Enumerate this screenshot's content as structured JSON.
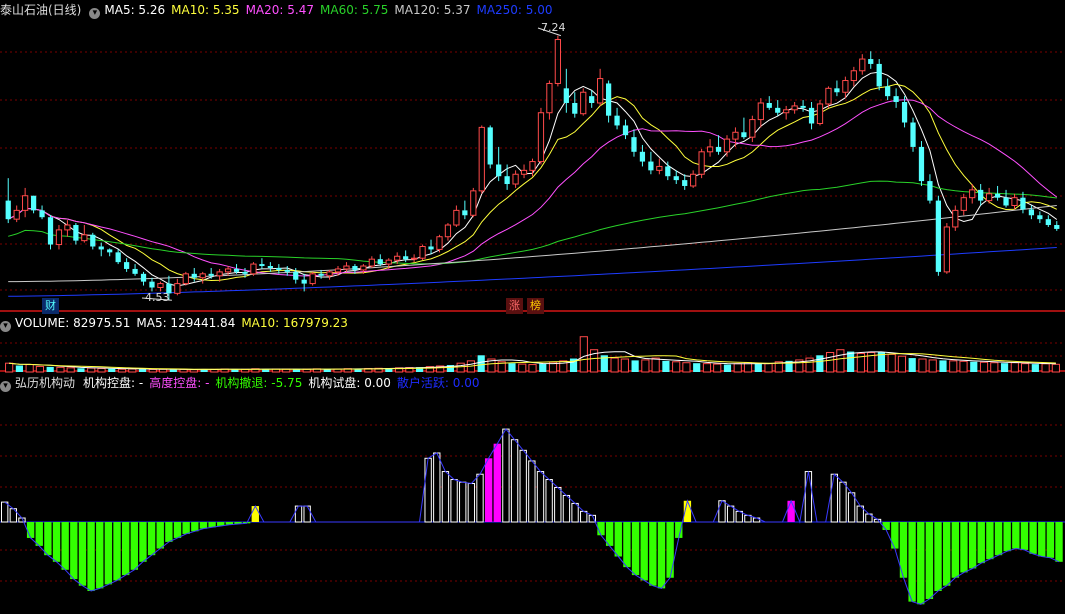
{
  "colors": {
    "up": "#ff4a4a",
    "down": "#54ffff",
    "ma5": "#ffffff",
    "ma10": "#ffff3c",
    "ma20": "#ff50ff",
    "ma60": "#29d129",
    "ma120": "#c8c8c8",
    "ma250": "#1e3cff",
    "divider": "#a01010",
    "grid": "#7a0000",
    "green": "#33ff00",
    "magenta": "#ff00ff",
    "yellow": "#ffff00",
    "blue": "#1e2cff"
  },
  "price_panel": {
    "title": "泰山石油(日线)",
    "items": [
      {
        "label": "MA5: 5.26",
        "color": "#ffffff"
      },
      {
        "label": "MA10: 5.35",
        "color": "#ffff3c"
      },
      {
        "label": "MA20: 5.47",
        "color": "#ff50ff"
      },
      {
        "label": "MA60: 5.75",
        "color": "#29d129"
      },
      {
        "label": "MA120: 5.37",
        "color": "#c8c8c8"
      },
      {
        "label": "MA250: 5.00",
        "color": "#1e3cff"
      }
    ],
    "high_label": "7.24",
    "low_label": "4.53",
    "markers": [
      {
        "text": "财"
      },
      {
        "text": "涨"
      },
      {
        "text": "榜"
      }
    ]
  },
  "volume_panel": {
    "items": [
      {
        "label": "VOLUME: 82975.51",
        "color": "#ffffff"
      },
      {
        "label": "MA5: 129441.84",
        "color": "#ffffff"
      },
      {
        "label": "MA10: 167979.23",
        "color": "#ffff3c"
      }
    ]
  },
  "indicator_panel": {
    "title": "弘历机构动",
    "items": [
      {
        "label": "机构控盘: -",
        "color": "#ffffff"
      },
      {
        "label": "高度控盘: -",
        "color": "#ff50ff"
      },
      {
        "label": "机构撤退: -5.75",
        "color": "#33ff00"
      },
      {
        "label": "机构试盘: 0.00",
        "color": "#ffffff"
      },
      {
        "label": "散户活跃: 0.00",
        "color": "#1e2cff"
      }
    ]
  },
  "chart_data": [
    {
      "type": "candlestick",
      "title": "泰山石油(日线)",
      "y_range": [
        4.45,
        7.4
      ],
      "high_point": 7.24,
      "low_point": 4.53,
      "candles": [
        [
          5.55,
          5.78,
          5.32,
          5.36
        ],
        [
          5.36,
          5.5,
          5.33,
          5.45
        ],
        [
          5.45,
          5.68,
          5.38,
          5.6
        ],
        [
          5.6,
          5.6,
          5.42,
          5.45
        ],
        [
          5.45,
          5.5,
          5.36,
          5.38
        ],
        [
          5.38,
          5.4,
          5.05,
          5.1
        ],
        [
          5.1,
          5.3,
          5.05,
          5.25
        ],
        [
          5.25,
          5.35,
          5.18,
          5.3
        ],
        [
          5.3,
          5.32,
          5.1,
          5.14
        ],
        [
          5.14,
          5.3,
          5.12,
          5.2
        ],
        [
          5.2,
          5.22,
          5.05,
          5.08
        ],
        [
          5.08,
          5.12,
          4.98,
          5.05
        ],
        [
          5.05,
          5.06,
          4.98,
          5.02
        ],
        [
          5.02,
          5.05,
          4.9,
          4.92
        ],
        [
          4.92,
          4.96,
          4.82,
          4.85
        ],
        [
          4.85,
          4.9,
          4.78,
          4.8
        ],
        [
          4.8,
          4.82,
          4.68,
          4.72
        ],
        [
          4.72,
          4.76,
          4.62,
          4.66
        ],
        [
          4.66,
          4.72,
          4.62,
          4.7
        ],
        [
          4.7,
          4.78,
          4.53,
          4.6
        ],
        [
          4.6,
          4.75,
          4.58,
          4.7
        ],
        [
          4.7,
          4.82,
          4.68,
          4.8
        ],
        [
          4.8,
          4.86,
          4.72,
          4.76
        ],
        [
          4.76,
          4.82,
          4.7,
          4.8
        ],
        [
          4.8,
          4.86,
          4.75,
          4.78
        ],
        [
          4.78,
          4.85,
          4.72,
          4.82
        ],
        [
          4.82,
          4.88,
          4.78,
          4.85
        ],
        [
          4.85,
          4.9,
          4.8,
          4.82
        ],
        [
          4.82,
          4.86,
          4.76,
          4.8
        ],
        [
          4.8,
          4.92,
          4.78,
          4.9
        ],
        [
          4.9,
          4.96,
          4.85,
          4.88
        ],
        [
          4.88,
          4.92,
          4.82,
          4.86
        ],
        [
          4.86,
          4.9,
          4.8,
          4.84
        ],
        [
          4.84,
          4.88,
          4.78,
          4.82
        ],
        [
          4.82,
          4.86,
          4.7,
          4.74
        ],
        [
          4.74,
          4.8,
          4.62,
          4.7
        ],
        [
          4.7,
          4.82,
          4.68,
          4.8
        ],
        [
          4.8,
          4.84,
          4.75,
          4.78
        ],
        [
          4.78,
          4.84,
          4.74,
          4.82
        ],
        [
          4.82,
          4.88,
          4.78,
          4.85
        ],
        [
          4.85,
          4.92,
          4.82,
          4.88
        ],
        [
          4.88,
          4.9,
          4.8,
          4.84
        ],
        [
          4.84,
          4.9,
          4.8,
          4.88
        ],
        [
          4.88,
          4.98,
          4.86,
          4.95
        ],
        [
          4.95,
          5.0,
          4.88,
          4.9
        ],
        [
          4.9,
          4.96,
          4.85,
          4.94
        ],
        [
          4.94,
          5.02,
          4.9,
          4.98
        ],
        [
          4.98,
          5.04,
          4.92,
          4.95
        ],
        [
          4.95,
          5.0,
          4.92,
          4.96
        ],
        [
          4.96,
          5.1,
          4.94,
          5.08
        ],
        [
          5.08,
          5.15,
          5.0,
          5.05
        ],
        [
          5.05,
          5.2,
          5.02,
          5.18
        ],
        [
          5.18,
          5.32,
          5.14,
          5.3
        ],
        [
          5.3,
          5.5,
          5.28,
          5.45
        ],
        [
          5.45,
          5.55,
          5.36,
          5.4
        ],
        [
          5.4,
          5.68,
          5.38,
          5.65
        ],
        [
          5.65,
          6.32,
          5.62,
          6.3
        ],
        [
          6.3,
          6.32,
          5.88,
          5.92
        ],
        [
          5.92,
          6.1,
          5.75,
          5.8
        ],
        [
          5.8,
          5.92,
          5.66,
          5.72
        ],
        [
          5.72,
          5.86,
          5.68,
          5.82
        ],
        [
          5.82,
          5.92,
          5.78,
          5.86
        ],
        [
          5.86,
          5.98,
          5.8,
          5.95
        ],
        [
          5.95,
          6.5,
          5.92,
          6.45
        ],
        [
          6.45,
          6.78,
          6.38,
          6.75
        ],
        [
          6.75,
          7.24,
          6.72,
          7.2
        ],
        [
          6.7,
          6.9,
          6.45,
          6.55
        ],
        [
          6.55,
          6.66,
          6.4,
          6.44
        ],
        [
          6.44,
          6.7,
          6.42,
          6.66
        ],
        [
          6.62,
          6.68,
          6.5,
          6.55
        ],
        [
          6.55,
          6.9,
          6.52,
          6.8
        ],
        [
          6.75,
          6.78,
          6.35,
          6.42
        ],
        [
          6.42,
          6.5,
          6.28,
          6.32
        ],
        [
          6.32,
          6.38,
          6.18,
          6.22
        ],
        [
          6.2,
          6.28,
          6.0,
          6.05
        ],
        [
          6.05,
          6.12,
          5.9,
          5.95
        ],
        [
          5.95,
          6.05,
          5.82,
          5.86
        ],
        [
          5.86,
          5.98,
          5.82,
          5.9
        ],
        [
          5.9,
          5.95,
          5.76,
          5.8
        ],
        [
          5.8,
          5.86,
          5.72,
          5.76
        ],
        [
          5.76,
          5.82,
          5.66,
          5.7
        ],
        [
          5.7,
          5.86,
          5.68,
          5.82
        ],
        [
          5.82,
          6.08,
          5.78,
          6.05
        ],
        [
          6.05,
          6.18,
          6.0,
          6.1
        ],
        [
          6.1,
          6.22,
          6.02,
          6.05
        ],
        [
          6.05,
          6.22,
          6.0,
          6.18
        ],
        [
          6.18,
          6.3,
          6.1,
          6.25
        ],
        [
          6.25,
          6.4,
          6.18,
          6.2
        ],
        [
          6.2,
          6.42,
          6.15,
          6.38
        ],
        [
          6.38,
          6.6,
          6.3,
          6.55
        ],
        [
          6.55,
          6.62,
          6.48,
          6.5
        ],
        [
          6.5,
          6.58,
          6.42,
          6.45
        ],
        [
          6.45,
          6.52,
          6.38,
          6.48
        ],
        [
          6.48,
          6.56,
          6.44,
          6.52
        ],
        [
          6.52,
          6.58,
          6.46,
          6.5
        ],
        [
          6.5,
          6.56,
          6.28,
          6.34
        ],
        [
          6.34,
          6.58,
          6.32,
          6.54
        ],
        [
          6.54,
          6.72,
          6.5,
          6.7
        ],
        [
          6.7,
          6.78,
          6.62,
          6.66
        ],
        [
          6.66,
          6.82,
          6.6,
          6.78
        ],
        [
          6.78,
          6.92,
          6.72,
          6.88
        ],
        [
          6.88,
          7.05,
          6.84,
          7.0
        ],
        [
          7.0,
          7.08,
          6.9,
          6.95
        ],
        [
          6.95,
          7.0,
          6.68,
          6.72
        ],
        [
          6.72,
          6.8,
          6.58,
          6.62
        ],
        [
          6.62,
          6.7,
          6.5,
          6.56
        ],
        [
          6.56,
          6.62,
          6.3,
          6.35
        ],
        [
          6.35,
          6.4,
          6.05,
          6.1
        ],
        [
          6.1,
          6.16,
          5.7,
          5.75
        ],
        [
          5.75,
          5.82,
          5.52,
          5.55
        ],
        [
          5.55,
          5.6,
          4.78,
          4.82
        ],
        [
          4.82,
          5.32,
          4.8,
          5.28
        ],
        [
          5.28,
          5.5,
          5.24,
          5.45
        ],
        [
          5.45,
          5.62,
          5.4,
          5.58
        ],
        [
          5.58,
          5.72,
          5.52,
          5.66
        ],
        [
          5.66,
          5.72,
          5.5,
          5.55
        ],
        [
          5.55,
          5.68,
          5.52,
          5.62
        ],
        [
          5.62,
          5.7,
          5.55,
          5.58
        ],
        [
          5.58,
          5.66,
          5.48,
          5.5
        ],
        [
          5.5,
          5.62,
          5.46,
          5.58
        ],
        [
          5.58,
          5.64,
          5.42,
          5.46
        ],
        [
          5.46,
          5.5,
          5.36,
          5.4
        ],
        [
          5.4,
          5.44,
          5.32,
          5.36
        ],
        [
          5.36,
          5.4,
          5.28,
          5.3
        ],
        [
          5.3,
          5.34,
          5.24,
          5.26
        ]
      ]
    },
    {
      "type": "bar",
      "title": "VOLUME",
      "y_range": [
        0,
        420000
      ],
      "values": [
        95000,
        70000,
        80000,
        60000,
        55000,
        50000,
        45000,
        40000,
        42000,
        38000,
        35000,
        30000,
        32000,
        30000,
        28000,
        30000,
        26000,
        28000,
        25000,
        30000,
        28000,
        32000,
        30000,
        28000,
        35000,
        30000,
        32000,
        30000,
        28000,
        30000,
        34000,
        30000,
        32000,
        36000,
        34000,
        38000,
        40000,
        42000,
        45000,
        48000,
        52000,
        58000,
        65000,
        75000,
        95000,
        120000,
        180000,
        140000,
        110000,
        95000,
        85000,
        80000,
        90000,
        105000,
        120000,
        145000,
        380000,
        240000,
        180000,
        150000,
        140000,
        125000,
        130000,
        150000,
        120000,
        110000,
        100000,
        95000,
        90000,
        85000,
        80000,
        90000,
        100000,
        95000,
        90000,
        110000,
        120000,
        130000,
        150000,
        180000,
        210000,
        240000,
        220000,
        200000,
        210000,
        215000,
        190000,
        170000,
        150000,
        140000,
        130000,
        125000,
        120000,
        115000,
        110000,
        105000,
        100000,
        95000,
        100000,
        90000,
        85000,
        88000,
        82975
      ],
      "series": [
        {
          "name": "MA5",
          "color": "#ffffff"
        },
        {
          "name": "MA10",
          "color": "#ffff3c"
        }
      ]
    },
    {
      "type": "bar",
      "title": "弘历机构动",
      "y_range": [
        -7.5,
        9
      ],
      "values": [
        1.5,
        1.0,
        0.3,
        -1.2,
        -1.8,
        -2.5,
        -3.0,
        -3.6,
        -4.3,
        -4.8,
        -5.2,
        -5.0,
        -4.7,
        -4.4,
        -4.0,
        -3.6,
        -3.0,
        -2.5,
        -2.0,
        -1.5,
        -1.2,
        -0.9,
        -0.7,
        -0.5,
        -0.4,
        -0.3,
        -0.2,
        -0.15,
        -0.1,
        1.2,
        0,
        0,
        0,
        0,
        1.2,
        1.2,
        0,
        0,
        0,
        0,
        0,
        0,
        0,
        0,
        0,
        0,
        0,
        0,
        0,
        4.8,
        5.2,
        3.8,
        3.2,
        3.0,
        2.9,
        3.6,
        4.8,
        5.9,
        7.0,
        6.2,
        5.4,
        4.6,
        3.8,
        3.2,
        2.6,
        2.0,
        1.4,
        0.8,
        0.5,
        -1.0,
        -1.8,
        -2.6,
        -3.4,
        -4.0,
        -4.4,
        -4.8,
        -5.0,
        -4.2,
        -1.2,
        1.6,
        0,
        0,
        0,
        1.6,
        1.2,
        0.8,
        0.5,
        0.3,
        0,
        0,
        0,
        1.6,
        0,
        3.8,
        0,
        0,
        3.6,
        3.0,
        2.2,
        1.2,
        0.6,
        0.2,
        -0.6,
        -2.0,
        -4.2,
        -6.0,
        -6.2,
        -5.8,
        -5.2,
        -4.8,
        -4.2,
        -3.8,
        -3.5,
        -3.1,
        -2.8,
        -2.5,
        -2.2,
        -2.0,
        -2.1,
        -2.4,
        -2.6,
        -2.7,
        -3.0
      ],
      "highlights": [
        {
          "index": 29,
          "color": "#ffff00"
        },
        {
          "index": 47,
          "color": "#ff00ff"
        },
        {
          "index": 48,
          "color": "#ff00ff"
        },
        {
          "index": 56,
          "color": "#ff00ff"
        },
        {
          "index": 57,
          "color": "#ff00ff"
        },
        {
          "index": 79,
          "color": "#ffff00"
        },
        {
          "index": 91,
          "color": "#ff00ff"
        }
      ]
    }
  ]
}
